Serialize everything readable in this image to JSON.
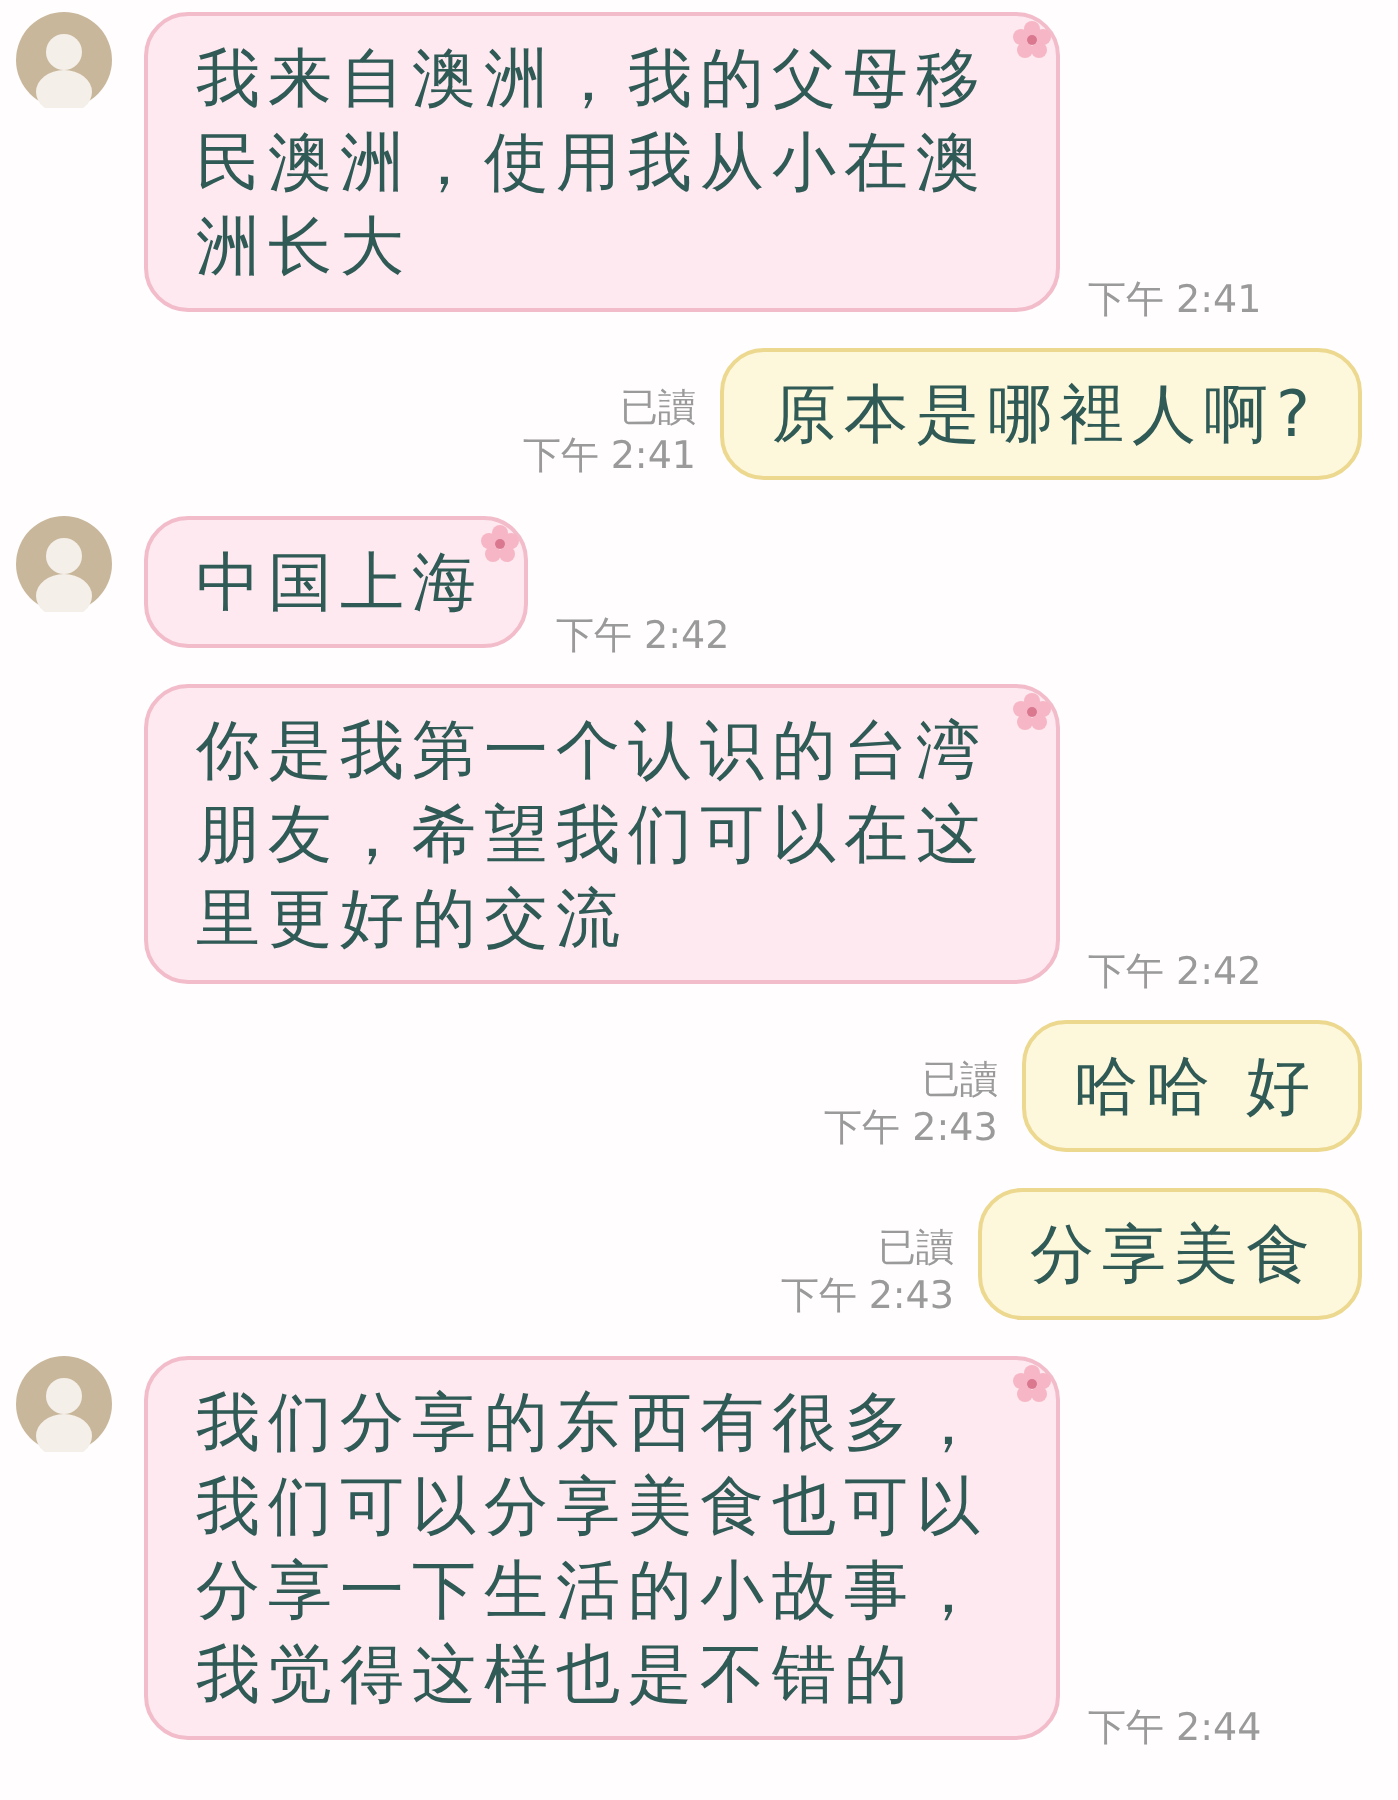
{
  "messages": [
    {
      "kind": "incoming",
      "avatar": true,
      "text": "我来自澳洲，我的父母移民澳洲，使用我从小在澳洲长大",
      "time": "下午 2:41"
    },
    {
      "kind": "outgoing",
      "read_label": "已讀",
      "text": "原本是哪裡人啊?",
      "time": "下午 2:41"
    },
    {
      "kind": "incoming",
      "avatar": true,
      "text": "中国上海",
      "time": "下午 2:42"
    },
    {
      "kind": "incoming",
      "avatar": false,
      "text": "你是我第一个认识的台湾朋友，希望我们可以在这里更好的交流",
      "time": "下午 2:42"
    },
    {
      "kind": "outgoing",
      "read_label": "已讀",
      "text": "哈哈 好",
      "time": "下午 2:43"
    },
    {
      "kind": "outgoing",
      "read_label": "已讀",
      "text": "分享美食",
      "time": "下午 2:43"
    },
    {
      "kind": "incoming",
      "avatar": true,
      "text": "我们分享的东西有很多，我们可以分享美食也可以分享一下生活的小故事，我觉得这样也是不错的",
      "time": "下午 2:44"
    }
  ]
}
